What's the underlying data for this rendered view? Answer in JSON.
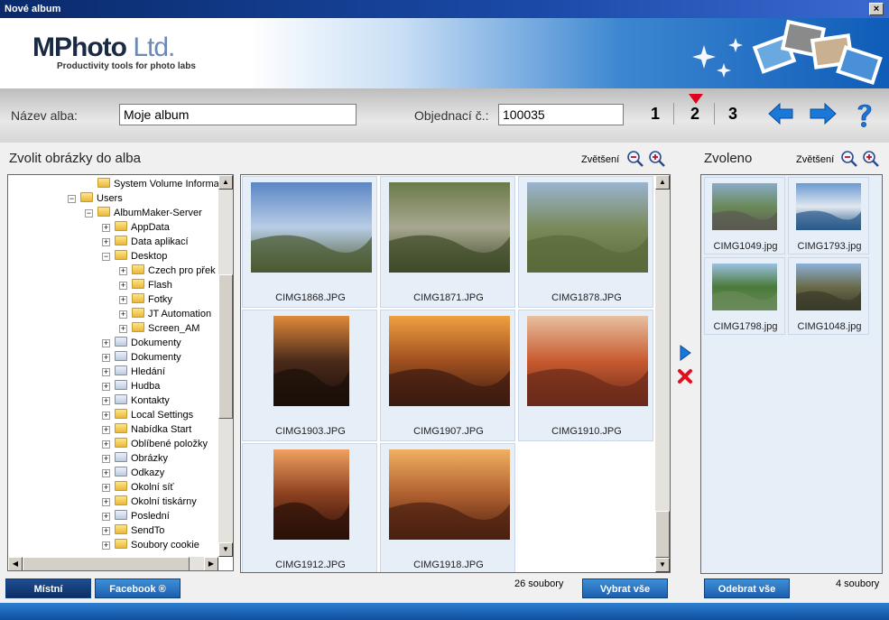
{
  "window": {
    "title": "Nové album",
    "close_symbol": "×"
  },
  "logo": {
    "main": "MPhoto",
    "ltd": "Ltd.",
    "tagline": "Productivity tools for photo labs"
  },
  "toolbar": {
    "album_name_label": "Název alba:",
    "album_name_value": "Moje album",
    "order_label": "Objednací č.:",
    "order_value": "100035",
    "steps": [
      "1",
      "2",
      "3"
    ],
    "active_step": "2"
  },
  "left": {
    "title": "Zvolit obrázky do alba",
    "zoom_label": "Zvětšení",
    "tree": [
      {
        "label": "System Volume Information",
        "level": 4
      },
      {
        "label": "Users",
        "level": 3
      },
      {
        "label": "AlbumMaker-Server",
        "level": 4
      },
      {
        "label": "AppData",
        "level": 5
      },
      {
        "label": "Data aplikací",
        "level": 5
      },
      {
        "label": "Desktop",
        "level": 5
      },
      {
        "label": "Czech pro přek",
        "level": 6
      },
      {
        "label": "Flash",
        "level": 6
      },
      {
        "label": "Fotky",
        "level": 6
      },
      {
        "label": "JT Automation",
        "level": 6
      },
      {
        "label": "Screen_AM",
        "level": 6
      },
      {
        "label": "Dokumenty",
        "level": 5
      },
      {
        "label": "Dokumenty",
        "level": 5
      },
      {
        "label": "Hledání",
        "level": 5
      },
      {
        "label": "Hudba",
        "level": 5
      },
      {
        "label": "Kontakty",
        "level": 5
      },
      {
        "label": "Local Settings",
        "level": 5
      },
      {
        "label": "Nabídka Start",
        "level": 5
      },
      {
        "label": "Oblíbené položky",
        "level": 5
      },
      {
        "label": "Obrázky",
        "level": 5
      },
      {
        "label": "Odkazy",
        "level": 5
      },
      {
        "label": "Okolní síť",
        "level": 5
      },
      {
        "label": "Okolní tiskárny",
        "level": 5
      },
      {
        "label": "Poslední",
        "level": 5
      },
      {
        "label": "SendTo",
        "level": 5
      },
      {
        "label": "Soubory cookie",
        "level": 5
      }
    ],
    "photos": [
      {
        "name": "CIMG1868.JPG",
        "colors": [
          "#5a86c4",
          "#b8cde6",
          "#4a5a30"
        ]
      },
      {
        "name": "CIMG1871.JPG",
        "colors": [
          "#6a7a4a",
          "#a8a890",
          "#3e4a28"
        ]
      },
      {
        "name": "CIMG1878.JPG",
        "colors": [
          "#9ab4d0",
          "#7a8a5a",
          "#5a6a3a"
        ]
      },
      {
        "name": "CIMG1903.JPG",
        "colors": [
          "#e08a3a",
          "#4a2a1a",
          "#1a0e08"
        ]
      },
      {
        "name": "CIMG1907.JPG",
        "colors": [
          "#f0a040",
          "#a05020",
          "#3a1a10"
        ]
      },
      {
        "name": "CIMG1910.JPG",
        "colors": [
          "#e8c0a0",
          "#c85a30",
          "#6a2a1a"
        ]
      },
      {
        "name": "CIMG1912.JPG",
        "colors": [
          "#f0a060",
          "#8a4020",
          "#2a1008"
        ]
      },
      {
        "name": "CIMG1918.JPG",
        "colors": [
          "#f0b060",
          "#b06030",
          "#4a2010"
        ]
      }
    ],
    "count": "26 soubory",
    "select_all": "Vybrat vše"
  },
  "right": {
    "title": "Zvoleno",
    "zoom_label": "Zvětšení",
    "photos": [
      {
        "name": "CIMG1049.jpg",
        "colors": [
          "#8aaac8",
          "#6a8a5a",
          "#5a5a50"
        ]
      },
      {
        "name": "CIMG1793.jpg",
        "colors": [
          "#6a9ad0",
          "#e0e8f0",
          "#2a5a8a"
        ]
      },
      {
        "name": "CIMG1798.jpg",
        "colors": [
          "#9ac0e0",
          "#4a7a3a",
          "#6a8a5a"
        ]
      },
      {
        "name": "CIMG1048.jpg",
        "colors": [
          "#8ab0d8",
          "#6a6a4a",
          "#3a3a2a"
        ]
      }
    ],
    "count": "4 soubory",
    "remove_all": "Odebrat vše"
  },
  "source_tabs": [
    "Místní",
    "Facebook ®"
  ],
  "colors": {
    "accent": "#1c5fae",
    "marker": "#e00020",
    "arrow": "#1a78d8"
  }
}
